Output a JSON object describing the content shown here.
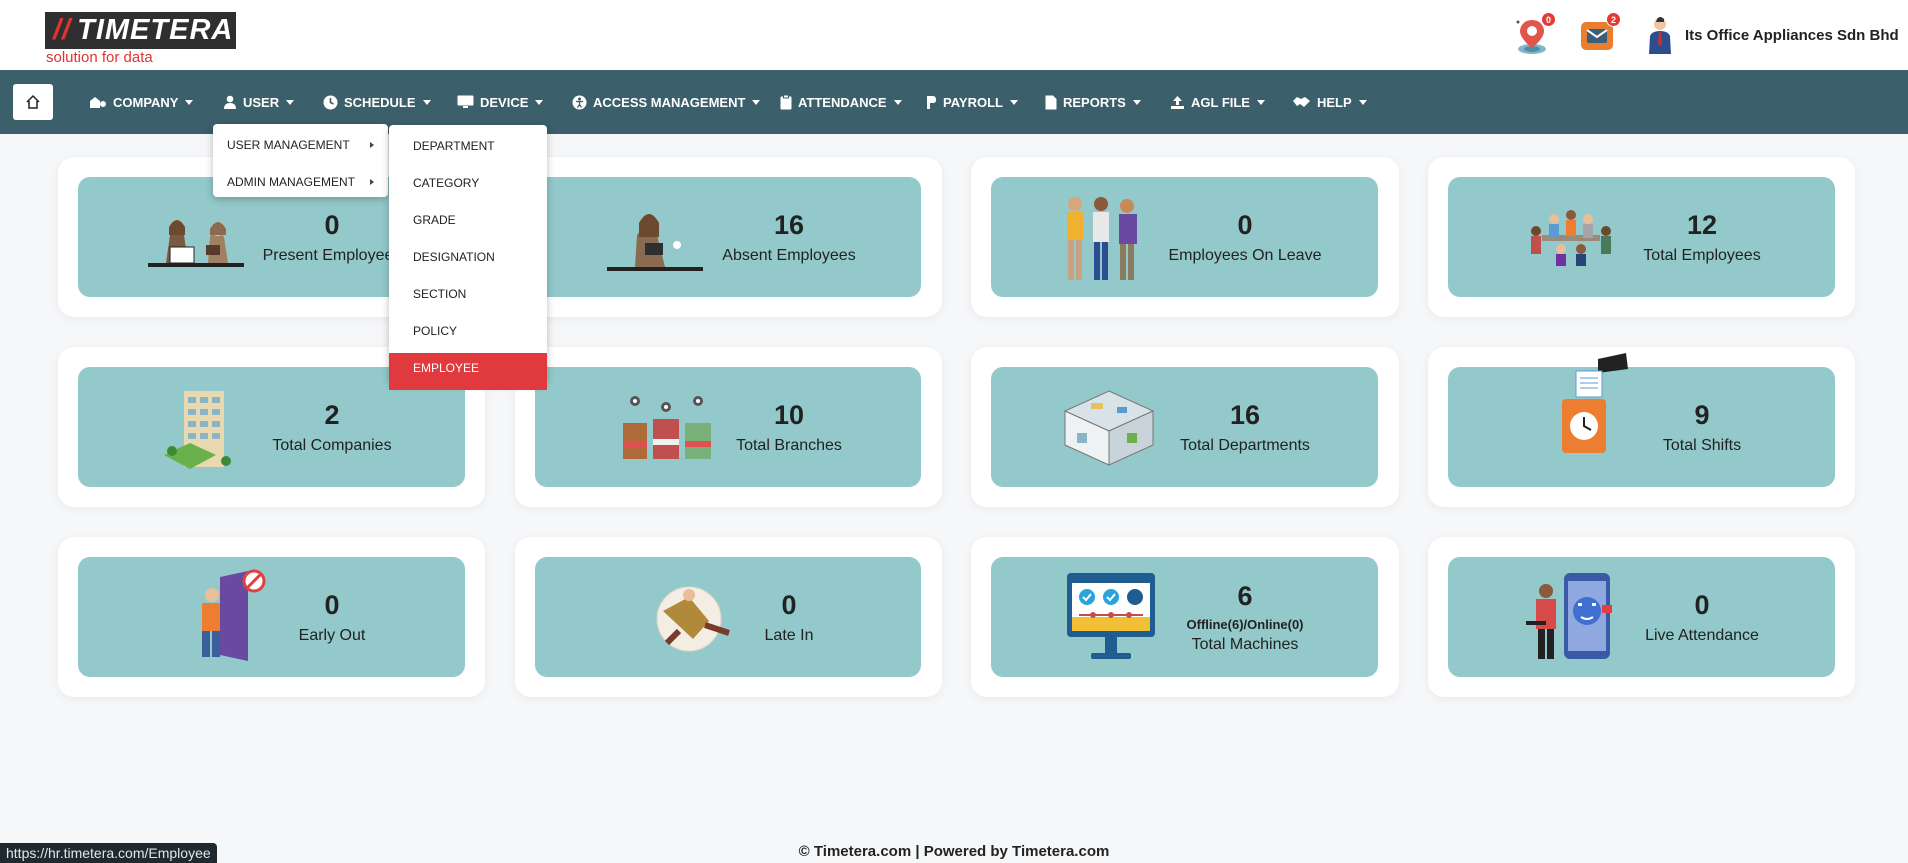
{
  "header": {
    "logo_text": "TIMETERA",
    "logo_tagline": "solution for data",
    "location_badge": "0",
    "mail_badge": "2",
    "company_name": "Its Office Appliances Sdn Bhd"
  },
  "nav": {
    "items": [
      {
        "label": "COMPANY",
        "icon": "company-icon"
      },
      {
        "label": "USER",
        "icon": "user-icon"
      },
      {
        "label": "SCHEDULE",
        "icon": "clock-icon"
      },
      {
        "label": "DEVICE",
        "icon": "monitor-icon"
      },
      {
        "label": "ACCESS MANAGEMENT",
        "icon": "access-icon"
      },
      {
        "label": "ATTENDANCE",
        "icon": "clipboard-icon"
      },
      {
        "label": "PAYROLL",
        "icon": "payroll-icon"
      },
      {
        "label": "REPORTS",
        "icon": "file-icon"
      },
      {
        "label": "AGL FILE",
        "icon": "upload-icon"
      },
      {
        "label": "HELP",
        "icon": "handshake-icon"
      }
    ]
  },
  "user_menu": {
    "items": [
      "USER MANAGEMENT",
      "ADMIN MANAGEMENT"
    ]
  },
  "user_management_submenu": {
    "items": [
      "DEPARTMENT",
      "CATEGORY",
      "GRADE",
      "DESIGNATION",
      "SECTION",
      "POLICY",
      "EMPLOYEE"
    ],
    "active": "EMPLOYEE"
  },
  "stats": [
    {
      "value": "0",
      "label": "Present Employees"
    },
    {
      "value": "16",
      "label": "Absent Employees"
    },
    {
      "value": "0",
      "label": "Employees On Leave"
    },
    {
      "value": "12",
      "label": "Total Employees"
    },
    {
      "value": "2",
      "label": "Total Companies"
    },
    {
      "value": "10",
      "label": "Total Branches"
    },
    {
      "value": "16",
      "label": "Total Departments"
    },
    {
      "value": "9",
      "label": "Total Shifts"
    },
    {
      "value": "0",
      "label": "Early Out"
    },
    {
      "value": "0",
      "label": "Late In"
    },
    {
      "value": "6",
      "label": "Total Machines",
      "sublabel": "Offline(6)/Online(0)"
    },
    {
      "value": "0",
      "label": "Live Attendance"
    }
  ],
  "footer": {
    "text": "© Timetera.com  |  Powered by Timetera.com"
  },
  "status_url": "https://hr.timetera.com/Employee",
  "colors": {
    "navbar": "#3b5f6b",
    "card_inner": "#93c9ca",
    "accent_red": "#e0393e"
  }
}
